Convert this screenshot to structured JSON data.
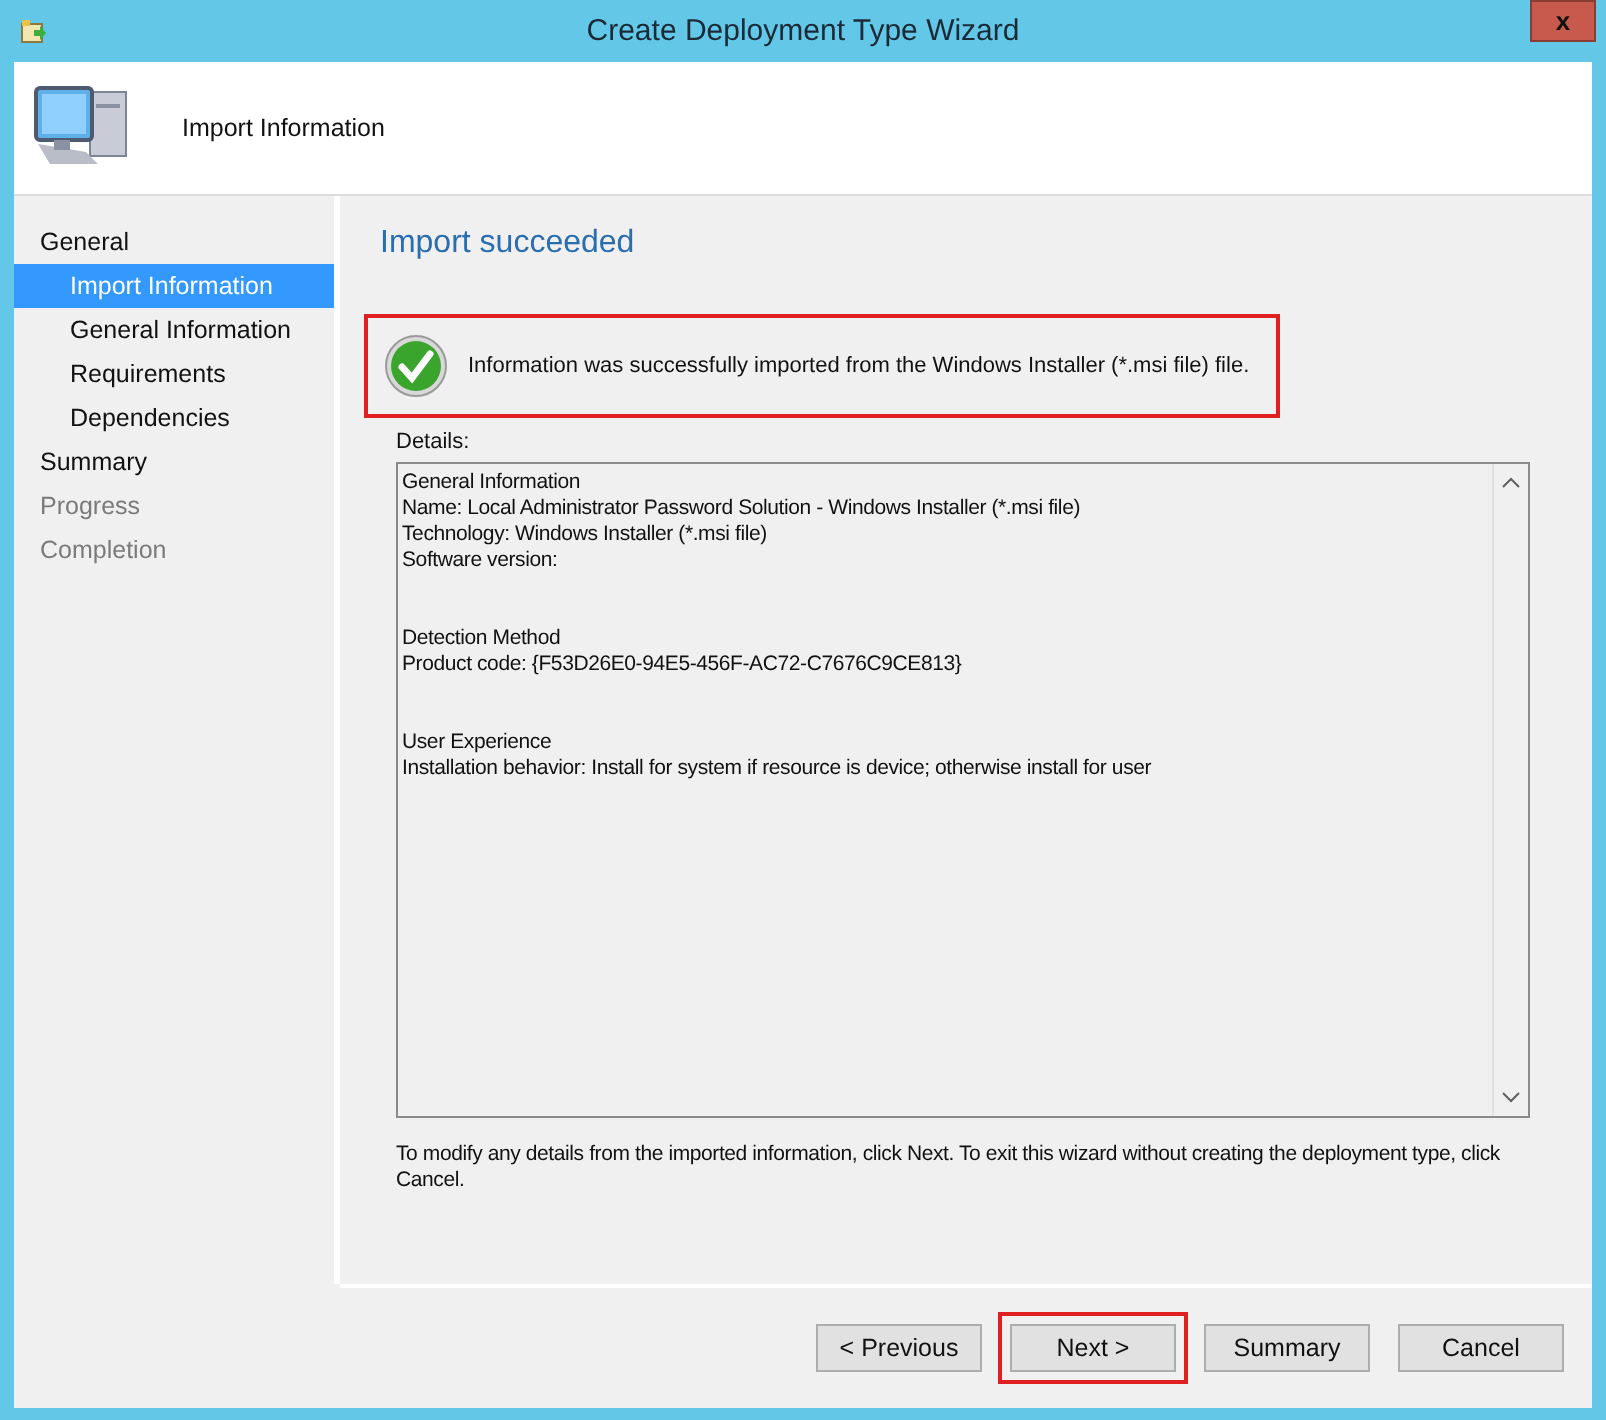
{
  "window": {
    "title": "Create Deployment Type Wizard",
    "close": "x"
  },
  "header": {
    "title": "Import Information"
  },
  "sidebar": {
    "items": [
      {
        "label": "General",
        "selected": false,
        "disabled": false,
        "children": [
          {
            "label": "Import Information",
            "selected": true,
            "disabled": false
          },
          {
            "label": "General Information",
            "selected": false,
            "disabled": false
          },
          {
            "label": "Requirements",
            "selected": false,
            "disabled": false
          },
          {
            "label": "Dependencies",
            "selected": false,
            "disabled": false
          }
        ]
      },
      {
        "label": "Summary",
        "selected": false,
        "disabled": false
      },
      {
        "label": "Progress",
        "selected": false,
        "disabled": true
      },
      {
        "label": "Completion",
        "selected": false,
        "disabled": true
      }
    ]
  },
  "page": {
    "heading": "Import succeeded",
    "message": {
      "text": "Information was successfully imported from the Windows Installer (*.msi file) file.",
      "highlighted": true
    },
    "details_label": "Details:",
    "details": [
      [
        "General Information",
        "Name: Local Administrator Password Solution - Windows Installer (*.msi file)",
        "Technology: Windows Installer (*.msi file)",
        "Software version:"
      ],
      [
        "Detection Method",
        "Product code: {F53D26E0-94E5-456F-AC72-C7676C9CE813}"
      ],
      [
        "User Experience",
        "Installation behavior: Install for system if resource is device; otherwise install for user"
      ]
    ],
    "note": "To modify any details from the imported information, click Next. To exit this wizard without creating the deployment type, click Cancel."
  },
  "buttons": [
    {
      "label": "< Previous",
      "highlighted": false
    },
    {
      "label": "Next >",
      "highlighted": true
    },
    {
      "label": "Summary",
      "highlighted": false
    },
    {
      "label": "Cancel",
      "highlighted": false
    }
  ]
}
